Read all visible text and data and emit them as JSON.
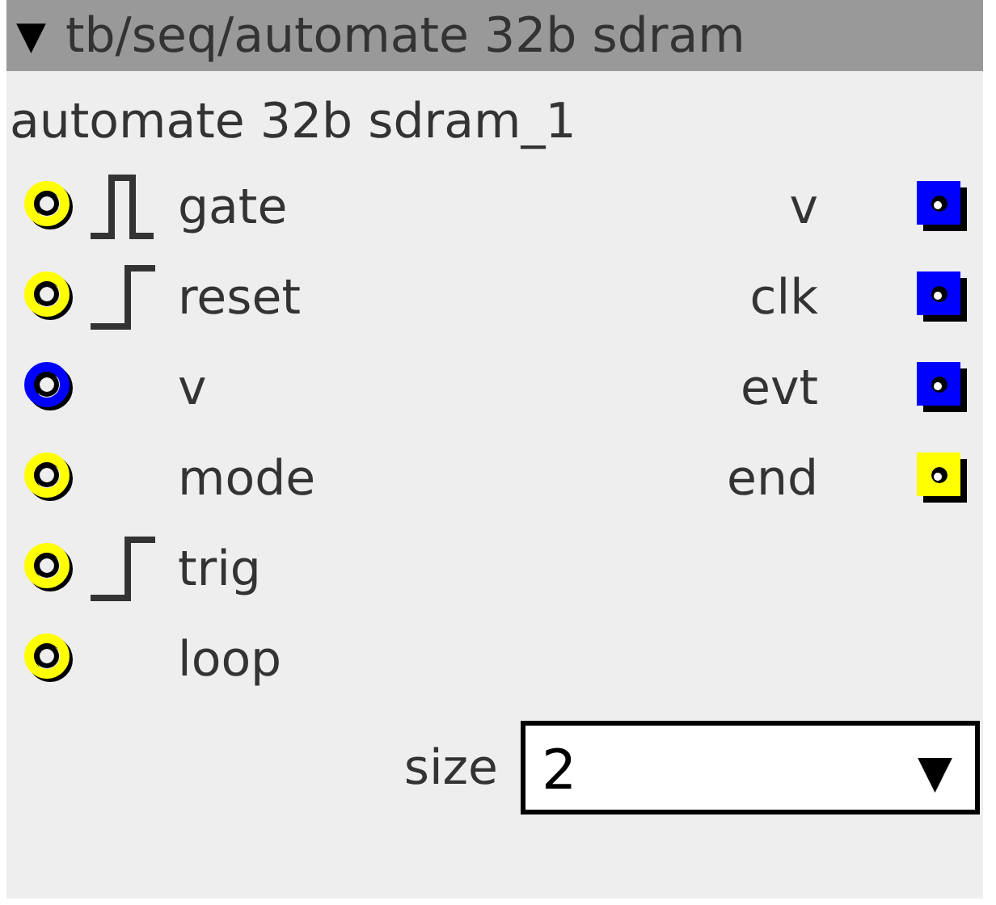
{
  "object": {
    "toggle": "▼",
    "path": "tb/seq/automate 32b sdram",
    "instance": "automate 32b sdram_1"
  },
  "inlets": [
    {
      "label": "gate",
      "color": "#ffff00",
      "kind": "pulse"
    },
    {
      "label": "reset",
      "color": "#ffff00",
      "kind": "step"
    },
    {
      "label": "v",
      "color": "#0000ff",
      "kind": "plain"
    },
    {
      "label": "mode",
      "color": "#ffff00",
      "kind": "plain"
    },
    {
      "label": "trig",
      "color": "#ffff00",
      "kind": "step"
    },
    {
      "label": "loop",
      "color": "#ffff00",
      "kind": "plain"
    }
  ],
  "outlets": [
    {
      "label": "v",
      "color": "#0000ff"
    },
    {
      "label": "clk",
      "color": "#0000ff"
    },
    {
      "label": "evt",
      "color": "#0000ff"
    },
    {
      "label": "end",
      "color": "#ffff00"
    }
  ],
  "attribute": {
    "label": "size",
    "value": "2",
    "arrow": "▼"
  }
}
